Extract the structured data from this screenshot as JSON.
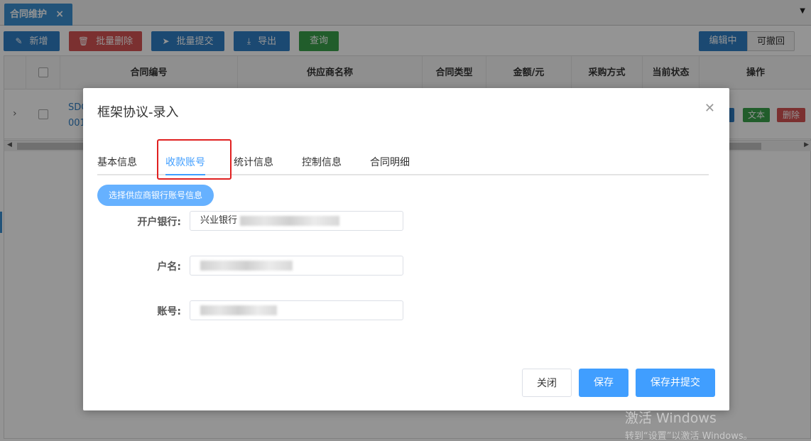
{
  "tab": {
    "title": "合同维护",
    "close_glyph": "×"
  },
  "toolbar": {
    "add_label": "新增",
    "batch_delete_label": "批量删除",
    "batch_submit_label": "批量提交",
    "export_label": "导出",
    "query_label": "查询",
    "editing_label": "编辑中",
    "withdrawable_label": "可撤回"
  },
  "grid": {
    "columns": [
      "合同编号",
      "供应商名称",
      "合同类型",
      "金额/元",
      "采购方式",
      "当前状态",
      "操作"
    ],
    "row": {
      "code_line1": "SDC",
      "code_line2": "001",
      "op_text_label": "文本",
      "op_delete_label": "删除"
    }
  },
  "modal": {
    "title": "框架协议-录入",
    "tabs": [
      "基本信息",
      "收款账号",
      "统计信息",
      "控制信息",
      "合同明细"
    ],
    "active_tab": "收款账号",
    "select_bank_button": "选择供应商银行账号信息",
    "fields": {
      "bank_label": "开户银行:",
      "bank_value": "兴业银行",
      "account_name_label": "户名:",
      "account_no_label": "账号:"
    },
    "buttons": {
      "close": "关闭",
      "save": "保存",
      "save_submit": "保存并提交"
    }
  },
  "watermark": {
    "title": "激活 Windows",
    "subtitle": "转到“设置”以激活 Windows。"
  },
  "colors": {
    "primary": "#409eff",
    "tab_blue": "#3b8fd0",
    "danger": "#d45454",
    "success": "#3aa04a",
    "highlight_red": "#e02020"
  }
}
